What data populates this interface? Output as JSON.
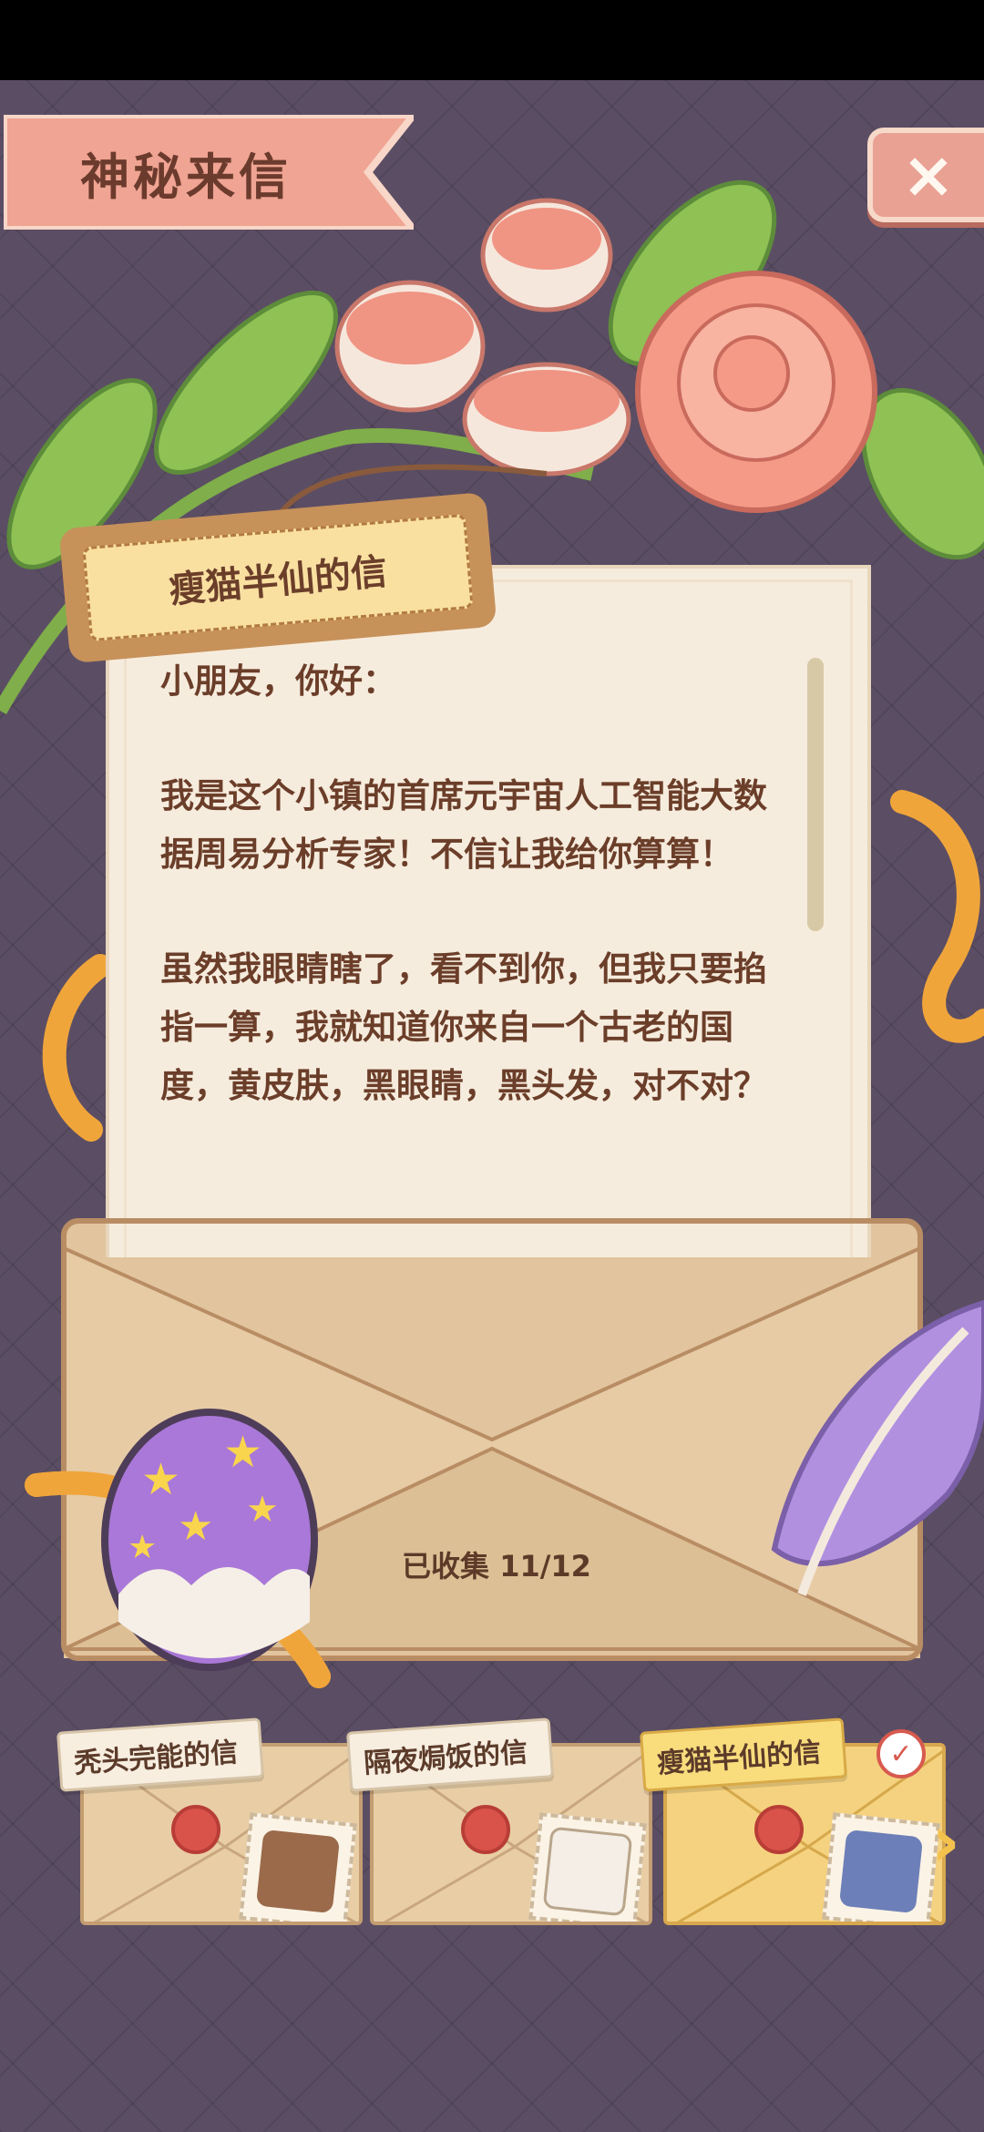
{
  "header": {
    "title": "神秘来信",
    "close_label": "×"
  },
  "letter": {
    "tag": "瘦猫半仙的信",
    "paragraphs": [
      "小朋友，你好：",
      "我是这个小镇的首席元宇宙人工智能大数据周易分析专家！不信让我给你算算！",
      "虽然我眼睛瞎了，看不到你，但我只要掐指一算，我就知道你来自一个古老的国度，黄皮肤，黑眼睛，黑头发，对不对？"
    ]
  },
  "collection": {
    "text": "已收集 11/12",
    "collected": 11,
    "total": 12
  },
  "cards": [
    {
      "label": "秃头完能的信",
      "stamp_icon": "owl-with-glasses-icon",
      "selected": false
    },
    {
      "label": "隔夜焗饭的信",
      "stamp_icon": "white-bird-icon",
      "selected": false
    },
    {
      "label": "瘦猫半仙的信",
      "stamp_icon": "blue-cat-icon",
      "selected": true
    }
  ],
  "selected_check": "✓",
  "next_arrow": "›",
  "colors": {
    "background": "#5b4e64",
    "ribbon": "#f0a493",
    "paper": "#f6ecdd",
    "envelope": "#e2c59e",
    "text": "#6b3e2a",
    "accent_yellow": "#f5d27f"
  }
}
